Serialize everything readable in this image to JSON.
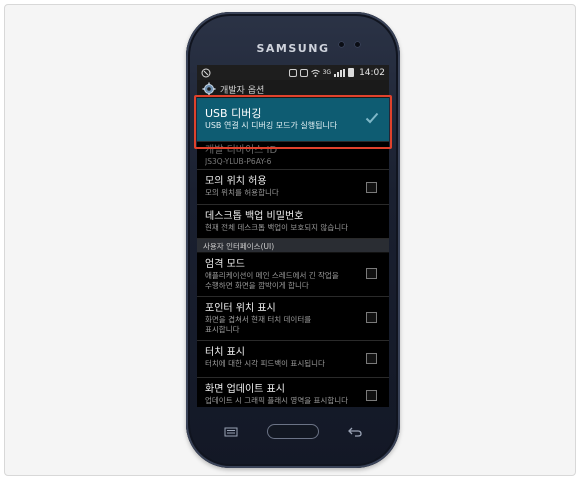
{
  "phone": {
    "brand": "SAMSUNG"
  },
  "statusbar": {
    "time": "14:02",
    "network": "3G"
  },
  "titlebar": {
    "title": "개발자 옵션"
  },
  "items": [
    {
      "title": "USB 디버깅",
      "subtitle": "USB 연결 시 디버깅 모드가 실행됩니다",
      "checked": true
    },
    {
      "title": "개발 디바이스 ID",
      "subtitle": "JS3Q-YLUB-P6AY-6"
    },
    {
      "title": "모의 위치 허용",
      "subtitle": "모의 위치를 허용합니다",
      "checked": false
    },
    {
      "title": "데스크톱 백업 비밀번호",
      "subtitle": "현재 전체 데스크톱 백업이 보호되지 않습니다"
    }
  ],
  "section": {
    "label": "사용자 인터페이스(UI)"
  },
  "items2": [
    {
      "title": "엄격 모드",
      "subtitle1": "애플리케이션이 메인 스레드에서 긴 작업을",
      "subtitle2": "수행하면 화면을 깜박이게 합니다",
      "checked": false
    },
    {
      "title": "포인터 위치 표시",
      "subtitle1": "화면을 겹쳐서 현재 터치 데이터를",
      "subtitle2": "표시합니다",
      "checked": false
    },
    {
      "title": "터치 표시",
      "subtitle": "터치에 대한 시각 피드백이 표시됩니다",
      "checked": false
    },
    {
      "title": "화면 업데이트 표시",
      "subtitle": "업데이트 시 그래픽 플래시 영역을 표시합니다",
      "checked": false
    }
  ],
  "colors": {
    "highlight": "#0e5c72",
    "annotation_box": "#e0422c"
  }
}
